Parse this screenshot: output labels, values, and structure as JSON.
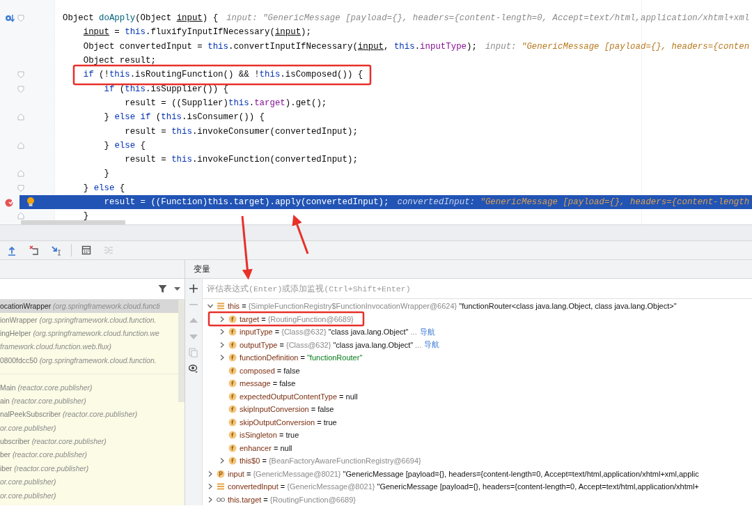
{
  "editor": {
    "lines": [
      {
        "tokens": [
          {
            "text": "Object ",
            "kind": "plain"
          },
          {
            "text": "doApply",
            "kind": "method"
          },
          {
            "text": "(Object ",
            "kind": "plain"
          },
          {
            "text": "input",
            "kind": "param"
          },
          {
            "text": ") {",
            "kind": "plain"
          }
        ],
        "hint": {
          "label": "input:",
          "value": "\"GenericMessage [payload={}, headers={content-length=0, Accept=text/html,application/xhtml+xml",
          "kind": "plain"
        },
        "markers": [
          {
            "kind": "override"
          }
        ],
        "fold": {
          "kind": "start"
        },
        "current": false
      },
      {
        "tokens": [
          {
            "text": "    input",
            "kind": "param"
          },
          {
            "text": " = ",
            "kind": "plain"
          },
          {
            "text": "this",
            "kind": "keyword"
          },
          {
            "text": ".fluxifyInputIfNecessary(",
            "kind": "plain"
          },
          {
            "text": "input",
            "kind": "param"
          },
          {
            "text": ");",
            "kind": "plain"
          }
        ],
        "current": false
      },
      {
        "tokens": [
          {
            "text": "    Object convertedInput = ",
            "kind": "plain"
          },
          {
            "text": "this",
            "kind": "keyword"
          },
          {
            "text": ".convertInputIfNecessary(",
            "kind": "plain"
          },
          {
            "text": "input",
            "kind": "param"
          },
          {
            "text": ", ",
            "kind": "plain"
          },
          {
            "text": "this",
            "kind": "keyword"
          },
          {
            "text": ".",
            "kind": "plain"
          },
          {
            "text": "inputType",
            "kind": "field"
          },
          {
            "text": ");",
            "kind": "plain"
          }
        ],
        "hint": {
          "label": "input:",
          "value": "\"GenericMessage [payload={}, headers={conten",
          "kind": "string"
        },
        "current": false
      },
      {
        "tokens": [
          {
            "text": "    Object result;",
            "kind": "plain"
          }
        ],
        "current": false
      },
      {
        "tokens": [
          {
            "text": "    if",
            "kind": "keyword"
          },
          {
            "text": " (!",
            "kind": "plain"
          },
          {
            "text": "this",
            "kind": "keyword"
          },
          {
            "text": ".isRoutingFunction() && !",
            "kind": "plain"
          },
          {
            "text": "this",
            "kind": "keyword"
          },
          {
            "text": ".isComposed()) {",
            "kind": "plain"
          }
        ],
        "fold": {
          "kind": "start"
        },
        "current": false
      },
      {
        "tokens": [
          {
            "text": "        if",
            "kind": "keyword"
          },
          {
            "text": " (",
            "kind": "plain"
          },
          {
            "text": "this",
            "kind": "keyword"
          },
          {
            "text": ".isSupplier()) {",
            "kind": "plain"
          }
        ],
        "fold": {
          "kind": "start"
        },
        "current": false
      },
      {
        "tokens": [
          {
            "text": "            result = ((Supplier)",
            "kind": "plain"
          },
          {
            "text": "this",
            "kind": "keyword"
          },
          {
            "text": ".",
            "kind": "plain"
          },
          {
            "text": "target",
            "kind": "field"
          },
          {
            "text": ").get();",
            "kind": "plain"
          }
        ],
        "current": false
      },
      {
        "tokens": [
          {
            "text": "        } ",
            "kind": "plain"
          },
          {
            "text": "else if",
            "kind": "keyword"
          },
          {
            "text": " (",
            "kind": "plain"
          },
          {
            "text": "this",
            "kind": "keyword"
          },
          {
            "text": ".isConsumer()) {",
            "kind": "plain"
          }
        ],
        "fold": {
          "kind": "end"
        },
        "current": false
      },
      {
        "tokens": [
          {
            "text": "            result = ",
            "kind": "plain"
          },
          {
            "text": "this",
            "kind": "keyword"
          },
          {
            "text": ".invokeConsumer(convertedInput);",
            "kind": "plain"
          }
        ],
        "current": false
      },
      {
        "tokens": [
          {
            "text": "        } ",
            "kind": "plain"
          },
          {
            "text": "else",
            "kind": "keyword"
          },
          {
            "text": " {",
            "kind": "plain"
          }
        ],
        "fold": {
          "kind": "end"
        },
        "current": false
      },
      {
        "tokens": [
          {
            "text": "            result = ",
            "kind": "plain"
          },
          {
            "text": "this",
            "kind": "keyword"
          },
          {
            "text": ".invokeFunction(convertedInput);",
            "kind": "plain"
          }
        ],
        "current": false
      },
      {
        "tokens": [
          {
            "text": "        }",
            "kind": "plain"
          }
        ],
        "fold": {
          "kind": "end"
        },
        "current": false
      },
      {
        "tokens": [
          {
            "text": "    } ",
            "kind": "plain"
          },
          {
            "text": "else",
            "kind": "keyword"
          },
          {
            "text": " {",
            "kind": "plain"
          }
        ],
        "fold": {
          "kind": "start"
        },
        "current": false
      },
      {
        "tokens": [
          {
            "text": "        result = ((Function)",
            "kind": "plain"
          },
          {
            "text": "this",
            "kind": "keyword"
          },
          {
            "text": ".target).apply(convertedInput);",
            "kind": "plain"
          }
        ],
        "hint": {
          "label": "convertedInput:",
          "value": "\"GenericMessage [payload={}, headers={content-length",
          "kind": "string"
        },
        "markers": [
          {
            "kind": "breakpoint"
          },
          {
            "kind": "bulb"
          }
        ],
        "current": true
      },
      {
        "tokens": [
          {
            "text": "    }",
            "kind": "plain"
          }
        ],
        "fold": {
          "kind": "end"
        },
        "current": false
      }
    ]
  },
  "debug_toolbar": [
    {
      "kind": "step-out",
      "disabled": false
    },
    {
      "kind": "drop-frame",
      "disabled": false
    },
    {
      "kind": "run-to-cursor",
      "disabled": false
    },
    {
      "kind": "evaluate",
      "disabled": false
    },
    {
      "kind": "trace",
      "disabled": true
    }
  ],
  "frames": [
    {
      "method": "ocationWrapper",
      "location": "(org.springframework.cloud.functi",
      "selected": true
    },
    {
      "method": "ionWrapper",
      "location": "(org.springframework.cloud.function.",
      "selected": false
    },
    {
      "method": "ingHelper",
      "location": "(org.springframework.cloud.function.we",
      "selected": false
    },
    {
      "location": "framework.cloud.function.web.flux)",
      "selected": false
    },
    {
      "method": "0800fdcc50",
      "location": "(org.springframework.cloud.function.",
      "selected": false
    },
    {
      "kind": "gap"
    },
    {
      "method": "Main",
      "location": "(reactor.core.publisher)",
      "selected": false
    },
    {
      "method": "ain",
      "location": "(reactor.core.publisher)",
      "selected": false
    },
    {
      "method": "nalPeekSubscriber",
      "location": "(reactor.core.publisher)",
      "selected": false
    },
    {
      "location": "or.core.publisher)",
      "selected": false
    },
    {
      "method": "ubscriber",
      "location": "(reactor.core.publisher)",
      "selected": false
    },
    {
      "method": "ber",
      "location": "(reactor.core.publisher)",
      "selected": false
    },
    {
      "method": "iber",
      "location": "(reactor.core.publisher)",
      "selected": false
    },
    {
      "location": "or.core.publisher)",
      "selected": false
    },
    {
      "location": "or.core.publisher)",
      "selected": false
    }
  ],
  "variables": {
    "title": "变量",
    "placeholder": "评估表达式(Enter)或添加监视(Ctrl+Shift+Enter)",
    "side_toolbar": [
      {
        "kind": "add",
        "disabled": false
      },
      {
        "kind": "remove",
        "disabled": true
      },
      {
        "kind": "up",
        "disabled": true
      },
      {
        "kind": "down",
        "disabled": true
      },
      {
        "kind": "copy",
        "disabled": true
      },
      {
        "kind": "watch",
        "disabled": false
      }
    ],
    "items": [
      {
        "name": "this",
        "kind": "object",
        "equals": "=",
        "ref": "{SimpleFunctionRegistry$FunctionInvocationWrapper@6624}",
        "value": "\"functionRouter<class java.lang.Object, class java.lang.Object>\"",
        "expanded": true,
        "children": [
          {
            "name": "target",
            "kind": "field",
            "equals": "=",
            "ref": "{RoutingFunction@6689}",
            "expanded": false
          },
          {
            "name": "inputType",
            "kind": "field",
            "equals": "=",
            "ref": "{Class@632}",
            "value": "\"class java.lang.Object\"",
            "more": "...",
            "nav": "导航",
            "expanded": false
          },
          {
            "name": "outputType",
            "kind": "field",
            "equals": "=",
            "ref": "{Class@632}",
            "value": "\"class java.lang.Object\"",
            "more": "...",
            "nav": "导航",
            "expanded": false
          },
          {
            "name": "functionDefinition",
            "kind": "field",
            "equals": "=",
            "string": "\"functionRouter\"",
            "expanded": false
          },
          {
            "name": "composed",
            "kind": "field",
            "equals": "=",
            "value": "false"
          },
          {
            "name": "message",
            "kind": "field",
            "equals": "=",
            "value": "false"
          },
          {
            "name": "expectedOutputContentType",
            "kind": "field",
            "equals": "=",
            "value": "null"
          },
          {
            "name": "skipInputConversion",
            "kind": "field",
            "equals": "=",
            "value": "false"
          },
          {
            "name": "skipOutputConversion",
            "kind": "field",
            "equals": "=",
            "value": "true"
          },
          {
            "name": "isSingleton",
            "kind": "field",
            "equals": "=",
            "value": "true"
          },
          {
            "name": "enhancer",
            "kind": "field",
            "equals": "=",
            "value": "null"
          },
          {
            "name": "this$0",
            "kind": "field",
            "equals": "=",
            "ref": "{BeanFactoryAwareFunctionRegistry@6694}",
            "expanded": false
          }
        ]
      },
      {
        "name": "input",
        "kind": "param",
        "equals": "=",
        "ref": "{GenericMessage@8021}",
        "value": "\"GenericMessage [payload={}, headers={content-length=0, Accept=text/html,application/xhtml+xml,applic",
        "expanded": false
      },
      {
        "name": "convertedInput",
        "kind": "object",
        "equals": "=",
        "ref": "{GenericMessage@8021}",
        "value": "\"GenericMessage [payload={}, headers={content-length=0, Accept=text/html,application/xhtml+",
        "expanded": false
      },
      {
        "name": "this.target",
        "kind": "watch",
        "equals": "=",
        "ref": "{RoutingFunction@6689}",
        "expanded": false
      }
    ]
  }
}
